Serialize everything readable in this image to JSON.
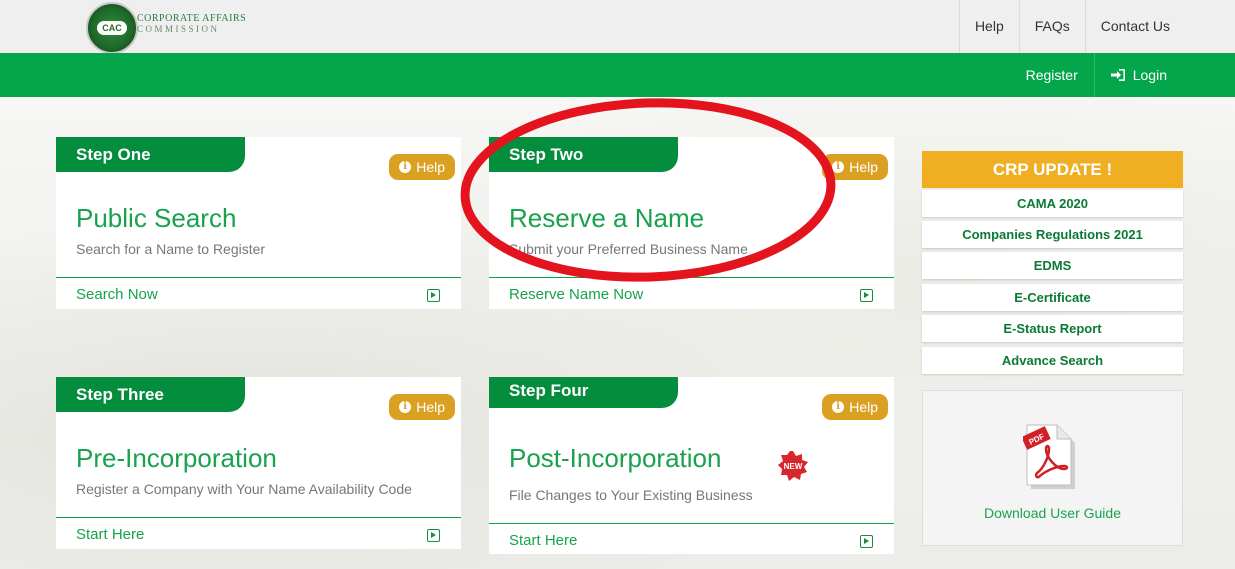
{
  "header": {
    "logo_name_line1": "CORPORATE AFFAIRS",
    "logo_name_line2": "COMMISSION",
    "logo_badge": "CAC",
    "top_nav": [
      "Help",
      "FAQs",
      "Contact Us"
    ],
    "register": "Register",
    "login": "Login"
  },
  "steps": [
    {
      "step": "Step One",
      "title": "Public Search",
      "subtitle": "Search for a Name to Register",
      "link": "Search Now",
      "help": "Help"
    },
    {
      "step": "Step Two",
      "title": "Reserve a Name",
      "subtitle": "Submit your Preferred Business Name",
      "link": "Reserve Name Now",
      "help": "Help"
    },
    {
      "step": "Step Three",
      "title": "Pre-Incorporation",
      "subtitle": "Register a Company with Your Name Availability Code",
      "link": "Start Here",
      "help": "Help"
    },
    {
      "step": "Step Four",
      "title": "Post-Incorporation",
      "subtitle": "File Changes to Your Existing Business",
      "link": "Start Here",
      "help": "Help",
      "badge": "NEW"
    }
  ],
  "crp": {
    "title": "CRP UPDATE !",
    "items": [
      "CAMA 2020",
      "Companies Regulations 2021",
      "EDMS",
      "E-Certificate",
      "E-Status Report",
      "Advance Search"
    ]
  },
  "guide": {
    "label": "Download User Guide",
    "icon": "pdf-file-icon",
    "icon_text": "PDF"
  },
  "colors": {
    "green": "#03a64b",
    "dark_green": "#048d3d",
    "gold": "#dba022",
    "orange": "#f0af22",
    "annotation": "#e3141e"
  }
}
